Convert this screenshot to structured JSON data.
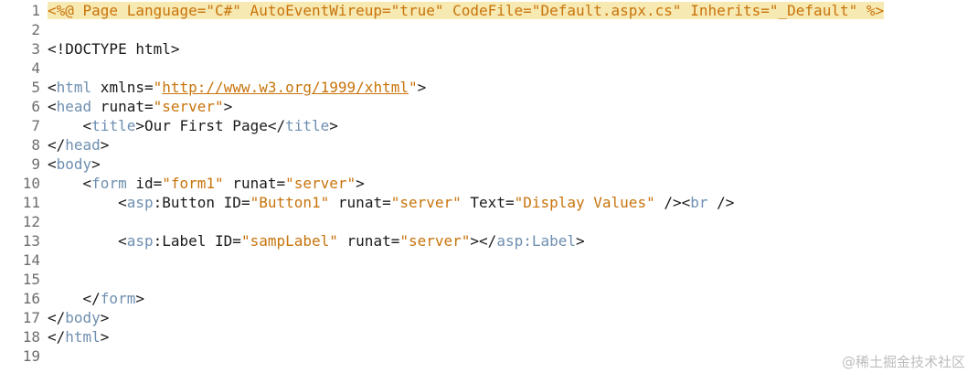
{
  "colors": {
    "tag": "#6e8fb0",
    "text": "#1a1a1a",
    "string": "#c8740c",
    "line_number": "#6e6e6e",
    "directive_highlight": "#f7e9b2"
  },
  "editor": {
    "lines": [
      {
        "num": "1",
        "highlight": true,
        "tokens": [
          {
            "t": "<%@ Page Language=\"C#\" AutoEventWireup=\"true\" CodeFile=\"Default.aspx.cs\" Inherits=\"_Default\" %>",
            "c": "dir"
          }
        ]
      },
      {
        "num": "2",
        "tokens": []
      },
      {
        "num": "3",
        "tokens": [
          {
            "t": "<!DOCTYPE html>",
            "c": "plain"
          }
        ]
      },
      {
        "num": "4",
        "tokens": []
      },
      {
        "num": "5",
        "tokens": [
          {
            "t": "<",
            "c": "plain"
          },
          {
            "t": "html",
            "c": "tag"
          },
          {
            "t": " xmlns=",
            "c": "plain"
          },
          {
            "t": "\"",
            "c": "str"
          },
          {
            "t": "http://www.w3.org/1999/xhtml",
            "c": "link"
          },
          {
            "t": "\"",
            "c": "str"
          },
          {
            "t": ">",
            "c": "plain"
          }
        ]
      },
      {
        "num": "6",
        "tokens": [
          {
            "t": "<",
            "c": "plain"
          },
          {
            "t": "head",
            "c": "tag"
          },
          {
            "t": " runat=",
            "c": "plain"
          },
          {
            "t": "\"server\"",
            "c": "str"
          },
          {
            "t": ">",
            "c": "plain"
          }
        ]
      },
      {
        "num": "7",
        "tokens": [
          {
            "t": "    <",
            "c": "plain"
          },
          {
            "t": "title",
            "c": "tag"
          },
          {
            "t": ">Our First Page</",
            "c": "plain"
          },
          {
            "t": "title",
            "c": "tag"
          },
          {
            "t": ">",
            "c": "plain"
          }
        ]
      },
      {
        "num": "8",
        "tokens": [
          {
            "t": "</",
            "c": "plain"
          },
          {
            "t": "head",
            "c": "tag"
          },
          {
            "t": ">",
            "c": "plain"
          }
        ]
      },
      {
        "num": "9",
        "tokens": [
          {
            "t": "<",
            "c": "plain"
          },
          {
            "t": "body",
            "c": "tag"
          },
          {
            "t": ">",
            "c": "plain"
          }
        ]
      },
      {
        "num": "10",
        "tokens": [
          {
            "t": "    <",
            "c": "plain"
          },
          {
            "t": "form",
            "c": "tag"
          },
          {
            "t": " id=",
            "c": "plain"
          },
          {
            "t": "\"form1\"",
            "c": "str"
          },
          {
            "t": " runat=",
            "c": "plain"
          },
          {
            "t": "\"server\"",
            "c": "str"
          },
          {
            "t": ">",
            "c": "plain"
          }
        ]
      },
      {
        "num": "11",
        "tokens": [
          {
            "t": "        <",
            "c": "plain"
          },
          {
            "t": "asp",
            "c": "tag"
          },
          {
            "t": ":Button ID=",
            "c": "plain"
          },
          {
            "t": "\"Button1\"",
            "c": "str"
          },
          {
            "t": " runat=",
            "c": "plain"
          },
          {
            "t": "\"server\"",
            "c": "str"
          },
          {
            "t": " Text=",
            "c": "plain"
          },
          {
            "t": "\"Display Values\"",
            "c": "str"
          },
          {
            "t": " /><",
            "c": "plain"
          },
          {
            "t": "br",
            "c": "tag"
          },
          {
            "t": " />",
            "c": "plain"
          }
        ]
      },
      {
        "num": "12",
        "tokens": []
      },
      {
        "num": "13",
        "tokens": [
          {
            "t": "        <",
            "c": "plain"
          },
          {
            "t": "asp",
            "c": "tag"
          },
          {
            "t": ":Label ID=",
            "c": "plain"
          },
          {
            "t": "\"sampLabel\"",
            "c": "str"
          },
          {
            "t": " runat=",
            "c": "plain"
          },
          {
            "t": "\"server\"",
            "c": "str"
          },
          {
            "t": "></",
            "c": "plain"
          },
          {
            "t": "asp:Label",
            "c": "tag"
          },
          {
            "t": ">",
            "c": "plain"
          }
        ]
      },
      {
        "num": "14",
        "tokens": []
      },
      {
        "num": "15",
        "tokens": []
      },
      {
        "num": "16",
        "tokens": [
          {
            "t": "    </",
            "c": "plain"
          },
          {
            "t": "form",
            "c": "tag"
          },
          {
            "t": ">",
            "c": "plain"
          }
        ]
      },
      {
        "num": "17",
        "tokens": [
          {
            "t": "</",
            "c": "plain"
          },
          {
            "t": "body",
            "c": "tag"
          },
          {
            "t": ">",
            "c": "plain"
          }
        ]
      },
      {
        "num": "18",
        "tokens": [
          {
            "t": "</",
            "c": "plain"
          },
          {
            "t": "html",
            "c": "tag"
          },
          {
            "t": ">",
            "c": "plain"
          }
        ]
      },
      {
        "num": "19",
        "tokens": []
      }
    ]
  },
  "watermark": "@稀土掘金技术社区"
}
